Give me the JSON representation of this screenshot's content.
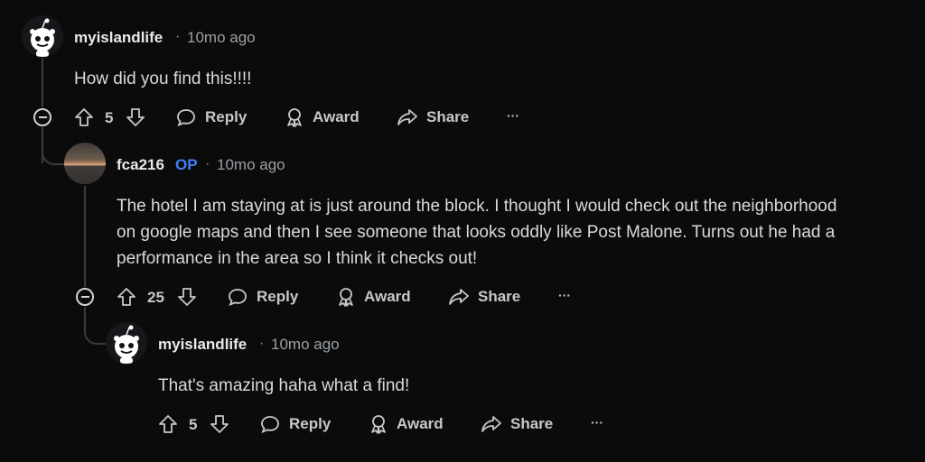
{
  "comments": [
    {
      "username": "myislandlife",
      "op": "",
      "separator": "·",
      "time": "10mo ago",
      "body": "How did you find this!!!!",
      "votes": "5",
      "actions": {
        "reply": "Reply",
        "award": "Award",
        "share": "Share",
        "more": "···"
      }
    },
    {
      "username": "fca216",
      "op": "OP",
      "separator": "·",
      "time": "10mo ago",
      "body_lines": [
        "The hotel I am staying at is just around the block. I thought I would check out the neighborhood",
        "on google maps and then I see someone that looks oddly like Post Malone. Turns out he had a",
        "performance in the area so I think it checks out!"
      ],
      "votes": "25",
      "actions": {
        "reply": "Reply",
        "award": "Award",
        "share": "Share",
        "more": "···"
      }
    },
    {
      "username": "myislandlife",
      "op": "",
      "separator": "·",
      "time": "10mo ago",
      "body": "That's amazing haha what a find!",
      "votes": "5",
      "actions": {
        "reply": "Reply",
        "award": "Award",
        "share": "Share",
        "more": "···"
      }
    }
  ]
}
